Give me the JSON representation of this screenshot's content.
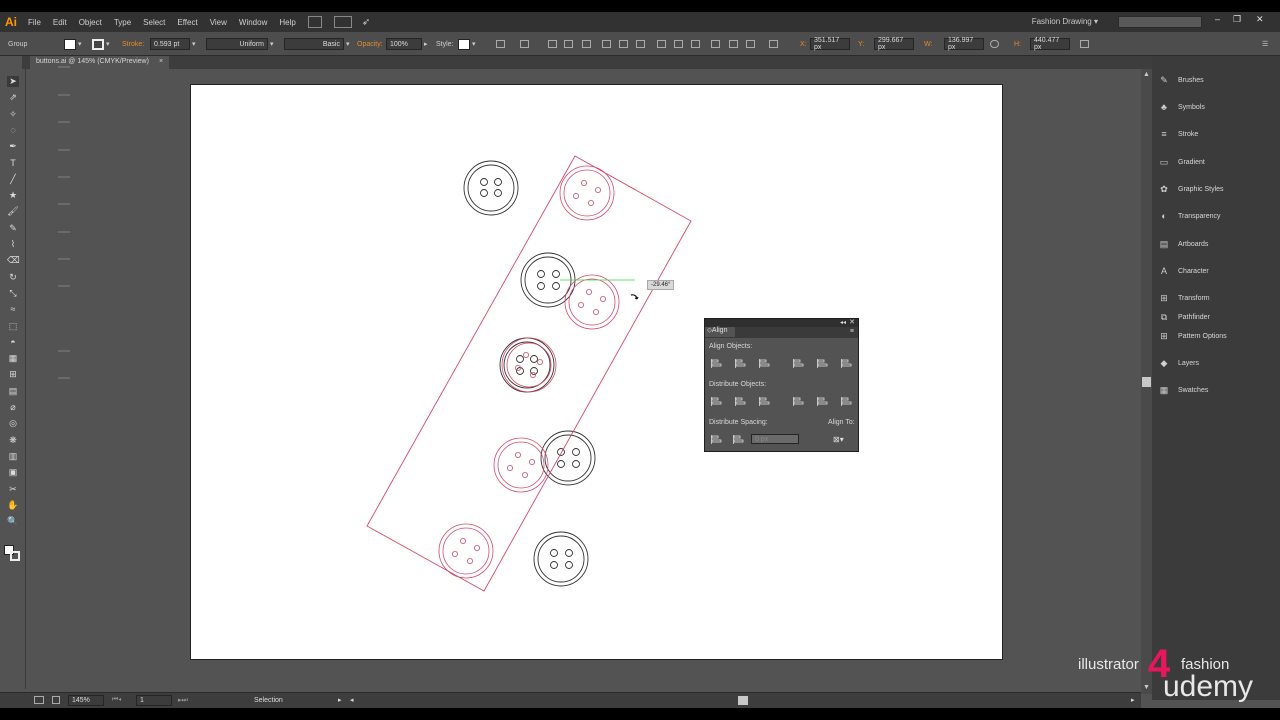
{
  "app": {
    "logo": "Ai"
  },
  "menu": [
    "File",
    "Edit",
    "Object",
    "Type",
    "Select",
    "Effect",
    "View",
    "Window",
    "Help"
  ],
  "menu_icons": [
    "bridge-icon",
    "arrange-documents-icon",
    "gpu-rocket-icon"
  ],
  "workspace": "Fashion Drawing",
  "window_controls": {
    "minimize": "–",
    "restore": "❐",
    "close": "✕"
  },
  "control": {
    "selection_type": "Group",
    "stroke_label": "Stroke:",
    "stroke_weight": "0.593 pt",
    "stroke_style": "Uniform",
    "brush": "Basic",
    "opacity_label": "Opacity:",
    "opacity": "100%",
    "style_label": "Style:",
    "x_label": "X:",
    "x": "351.517 px",
    "y_label": "Y:",
    "y": "299.667 px",
    "w_label": "W:",
    "w": "136.997 px",
    "h_label": "H:",
    "h": "440.477 px"
  },
  "document_tab": {
    "title": "buttons.ai @ 145% (CMYK/Preview)",
    "close": "×"
  },
  "tools": [
    "selection-tool-icon",
    "direct-selection-tool-icon",
    "magic-wand-tool-icon",
    "lasso-tool-icon",
    "pen-tool-icon",
    "type-tool-icon",
    "line-tool-icon",
    "star-tool-icon",
    "paintbrush-tool-icon",
    "pencil-tool-icon",
    "blob-brush-tool-icon",
    "eraser-tool-icon",
    "rotate-tool-icon",
    "scale-tool-icon",
    "warp-tool-icon",
    "free-transform-tool-icon",
    "shape-builder-tool-icon",
    "perspective-tool-icon",
    "mesh-tool-icon",
    "gradient-tool-icon",
    "eyedropper-tool-icon",
    "blend-tool-icon",
    "symbol-sprayer-tool-icon",
    "graph-tool-icon",
    "artboard-tool-icon",
    "slice-tool-icon",
    "hand-tool-icon",
    "zoom-tool-icon"
  ],
  "panels": [
    {
      "label": "Brushes",
      "icon": "brushes-icon"
    },
    {
      "label": "Symbols",
      "icon": "symbols-icon"
    },
    {
      "label": "Stroke",
      "icon": "stroke-icon"
    },
    {
      "label": "Gradient",
      "icon": "gradient-icon"
    },
    {
      "label": "Graphic Styles",
      "icon": "graphic-styles-icon"
    },
    {
      "label": "Transparency",
      "icon": "transparency-icon"
    },
    {
      "label": "Artboards",
      "icon": "artboards-icon"
    },
    {
      "label": "Character",
      "icon": "character-icon"
    },
    {
      "label": "Transform",
      "icon": "transform-icon"
    },
    {
      "label": "Pathfinder",
      "icon": "pathfinder-icon"
    },
    {
      "label": "Pattern Options",
      "icon": "pattern-options-icon"
    },
    {
      "label": "Layers",
      "icon": "layers-icon"
    },
    {
      "label": "Swatches",
      "icon": "swatches-icon"
    }
  ],
  "align_panel": {
    "title": "Align",
    "align_objects": "Align Objects:",
    "distribute_objects": "Distribute Objects:",
    "distribute_spacing": "Distribute Spacing:",
    "align_to": "Align To:",
    "spacing_value": "0 px"
  },
  "rotate_tooltip": "-29.46°",
  "status": {
    "zoom": "145%",
    "artboard": "1",
    "tool": "Selection"
  },
  "branding": {
    "line1": "illustrator",
    "number": "4",
    "line2": "fashion",
    "platform": "udemy"
  },
  "colors": {
    "selection": "#e0406a",
    "accent": "#ff9a00",
    "guide": "#3bd24a"
  }
}
